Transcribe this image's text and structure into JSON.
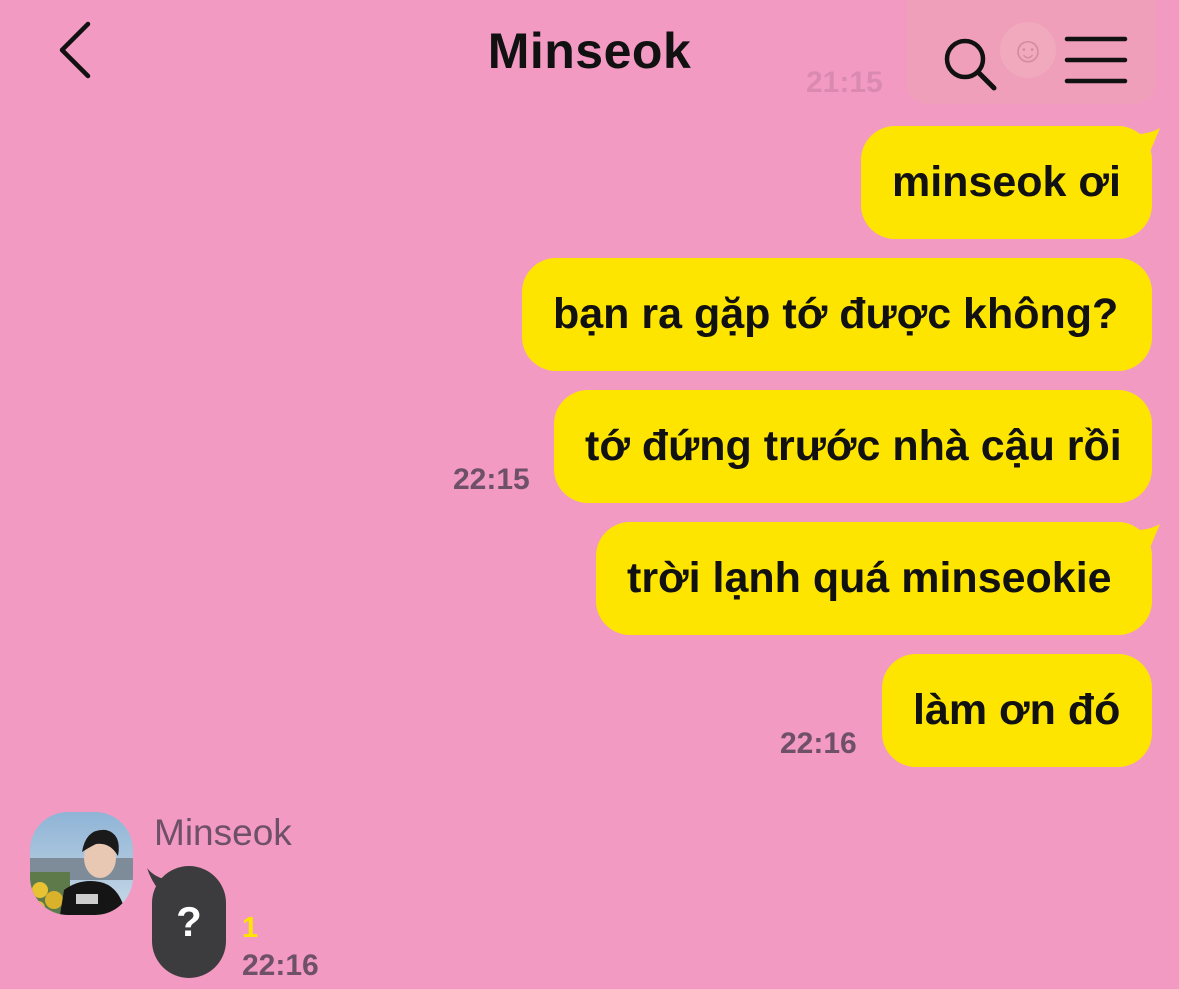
{
  "header": {
    "title": "Minseok",
    "ghost_time": "21:15"
  },
  "messages_out": [
    {
      "text": "minseok ơi",
      "tail": true
    },
    {
      "text": "bạn ra gặp tớ được không?",
      "tail": false
    },
    {
      "text": "tớ đứng trước nhà cậu rồi",
      "tail": false,
      "time": "22:15"
    },
    {
      "text": "trời lạnh quá minseokie",
      "tail": true
    },
    {
      "text": "làm ơn đó",
      "tail": false,
      "time": "22:16"
    }
  ],
  "incoming": {
    "sender": "Minseok",
    "text": "?",
    "unread_count": "1",
    "time": "22:16"
  },
  "colors": {
    "background": "#F39AC3",
    "bubble_out": "#FEE500",
    "bubble_in": "#3C3C3E",
    "timestamp": "#6E5068",
    "unread": "#FFE500"
  },
  "icons": [
    "chevron-left-icon",
    "search-icon",
    "menu-icon"
  ]
}
